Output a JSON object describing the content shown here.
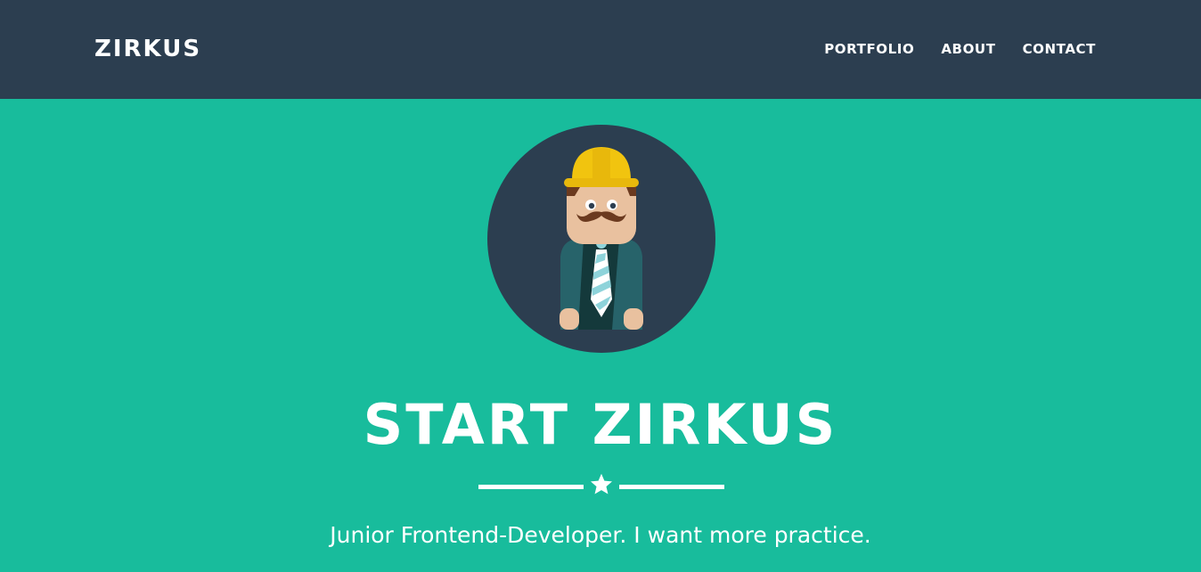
{
  "navbar": {
    "brand": "ZIRKUS",
    "links": [
      {
        "label": "PORTFOLIO"
      },
      {
        "label": "ABOUT"
      },
      {
        "label": "CONTACT"
      }
    ]
  },
  "header": {
    "avatar_icon": "construction-worker-avatar-icon",
    "title": "START ZIRKUS",
    "divider_icon": "star-icon",
    "tagline": "Junior Frontend-Developer. I want more practice."
  },
  "colors": {
    "navbar_bg": "#2c3e50",
    "header_bg": "#18bc9c",
    "text": "#ffffff",
    "avatar_circle": "#2c3e50",
    "helmet": "#f1c40f"
  }
}
